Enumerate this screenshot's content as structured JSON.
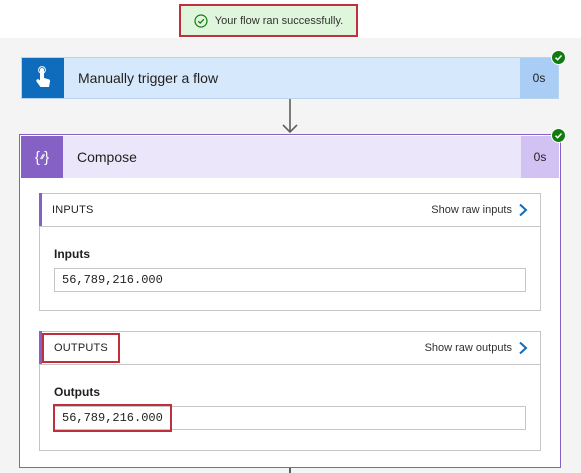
{
  "toast": {
    "message": "Your flow ran successfully."
  },
  "trigger": {
    "title": "Manually trigger a flow",
    "duration": "0s",
    "icon": "touch-hand-icon"
  },
  "compose": {
    "title": "Compose",
    "duration": "0s",
    "icon": "braces-icon",
    "inputs": {
      "header": "INPUTS",
      "show_raw_label": "Show raw inputs",
      "field_label": "Inputs",
      "field_value": "56,789,216.000"
    },
    "outputs": {
      "header": "OUTPUTS",
      "show_raw_label": "Show raw outputs",
      "field_label": "Outputs",
      "field_value": "56,789,216.000"
    }
  },
  "colors": {
    "success": "#107c10",
    "highlight": "#c0303a",
    "trigger_accent": "#0f6cbd",
    "compose_accent": "#8661c5"
  }
}
